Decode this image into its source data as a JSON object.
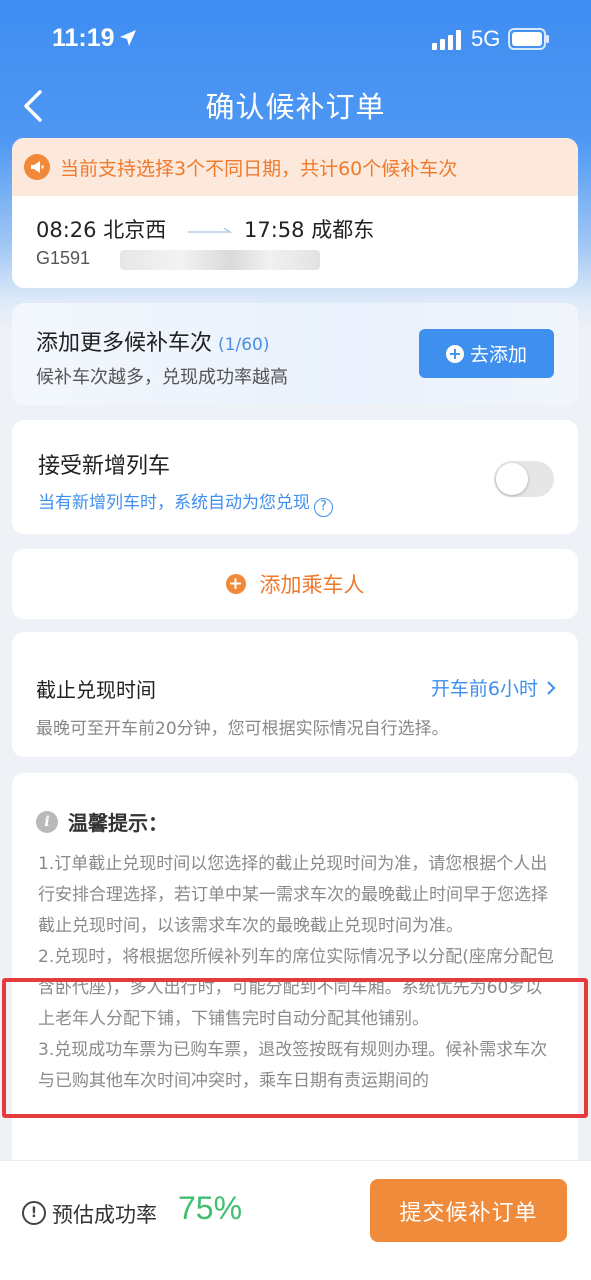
{
  "status_bar": {
    "time": "11:19",
    "network": "5G"
  },
  "nav": {
    "title": "确认候补订单"
  },
  "trip": {
    "notice": "当前支持选择3个不同日期，共计60个候补车次",
    "departure": "08:26 北京西",
    "arrival": "17:58 成都东",
    "train_no": "G1591"
  },
  "add_trains": {
    "title": "添加更多候补车次",
    "count": "(1/60)",
    "subtitle": "候补车次越多，兑现成功率越高",
    "button_label": "去添加"
  },
  "new_train": {
    "title": "接受新增列车",
    "subtitle": "当有新增列车时，系统自动为您兑现",
    "toggle_on": false
  },
  "add_passenger": {
    "label": "添加乘车人"
  },
  "deadline": {
    "title": "截止兑现时间",
    "value": "开车前6小时",
    "subtitle": "最晚可至开车前20分钟，您可根据实际情况自行选择。"
  },
  "tips": {
    "title": "温馨提示：",
    "items": [
      "1.订单截止兑现时间以您选择的截止兑现时间为准，请您根据个人出行安排合理选择，若订单中某一需求车次的最晚截止时间早于您选择截止兑现时间，以该需求车次的最晚截止兑现时间为准。",
      "2.兑现时，将根据您所候补列车的席位实际情况予以分配(座席分配包含卧代座)，多人出行时，可能分配到不同车厢。系统优先为60岁以上老年人分配下铺，下铺售完时自动分配其他铺别。",
      "3.兑现成功车票为已购车票，退改签按既有规则办理。候补需求车次与已购其他车次时间冲突时，乘车日期有责运期间的"
    ]
  },
  "bottom": {
    "rate_label": "预估成功率",
    "rate_value": "75%",
    "submit_label": "提交候补订单"
  },
  "colors": {
    "primary": "#3f8fef",
    "accent": "#ef8b3a",
    "success": "#3fbf6f",
    "highlight": "#e53b3b"
  }
}
